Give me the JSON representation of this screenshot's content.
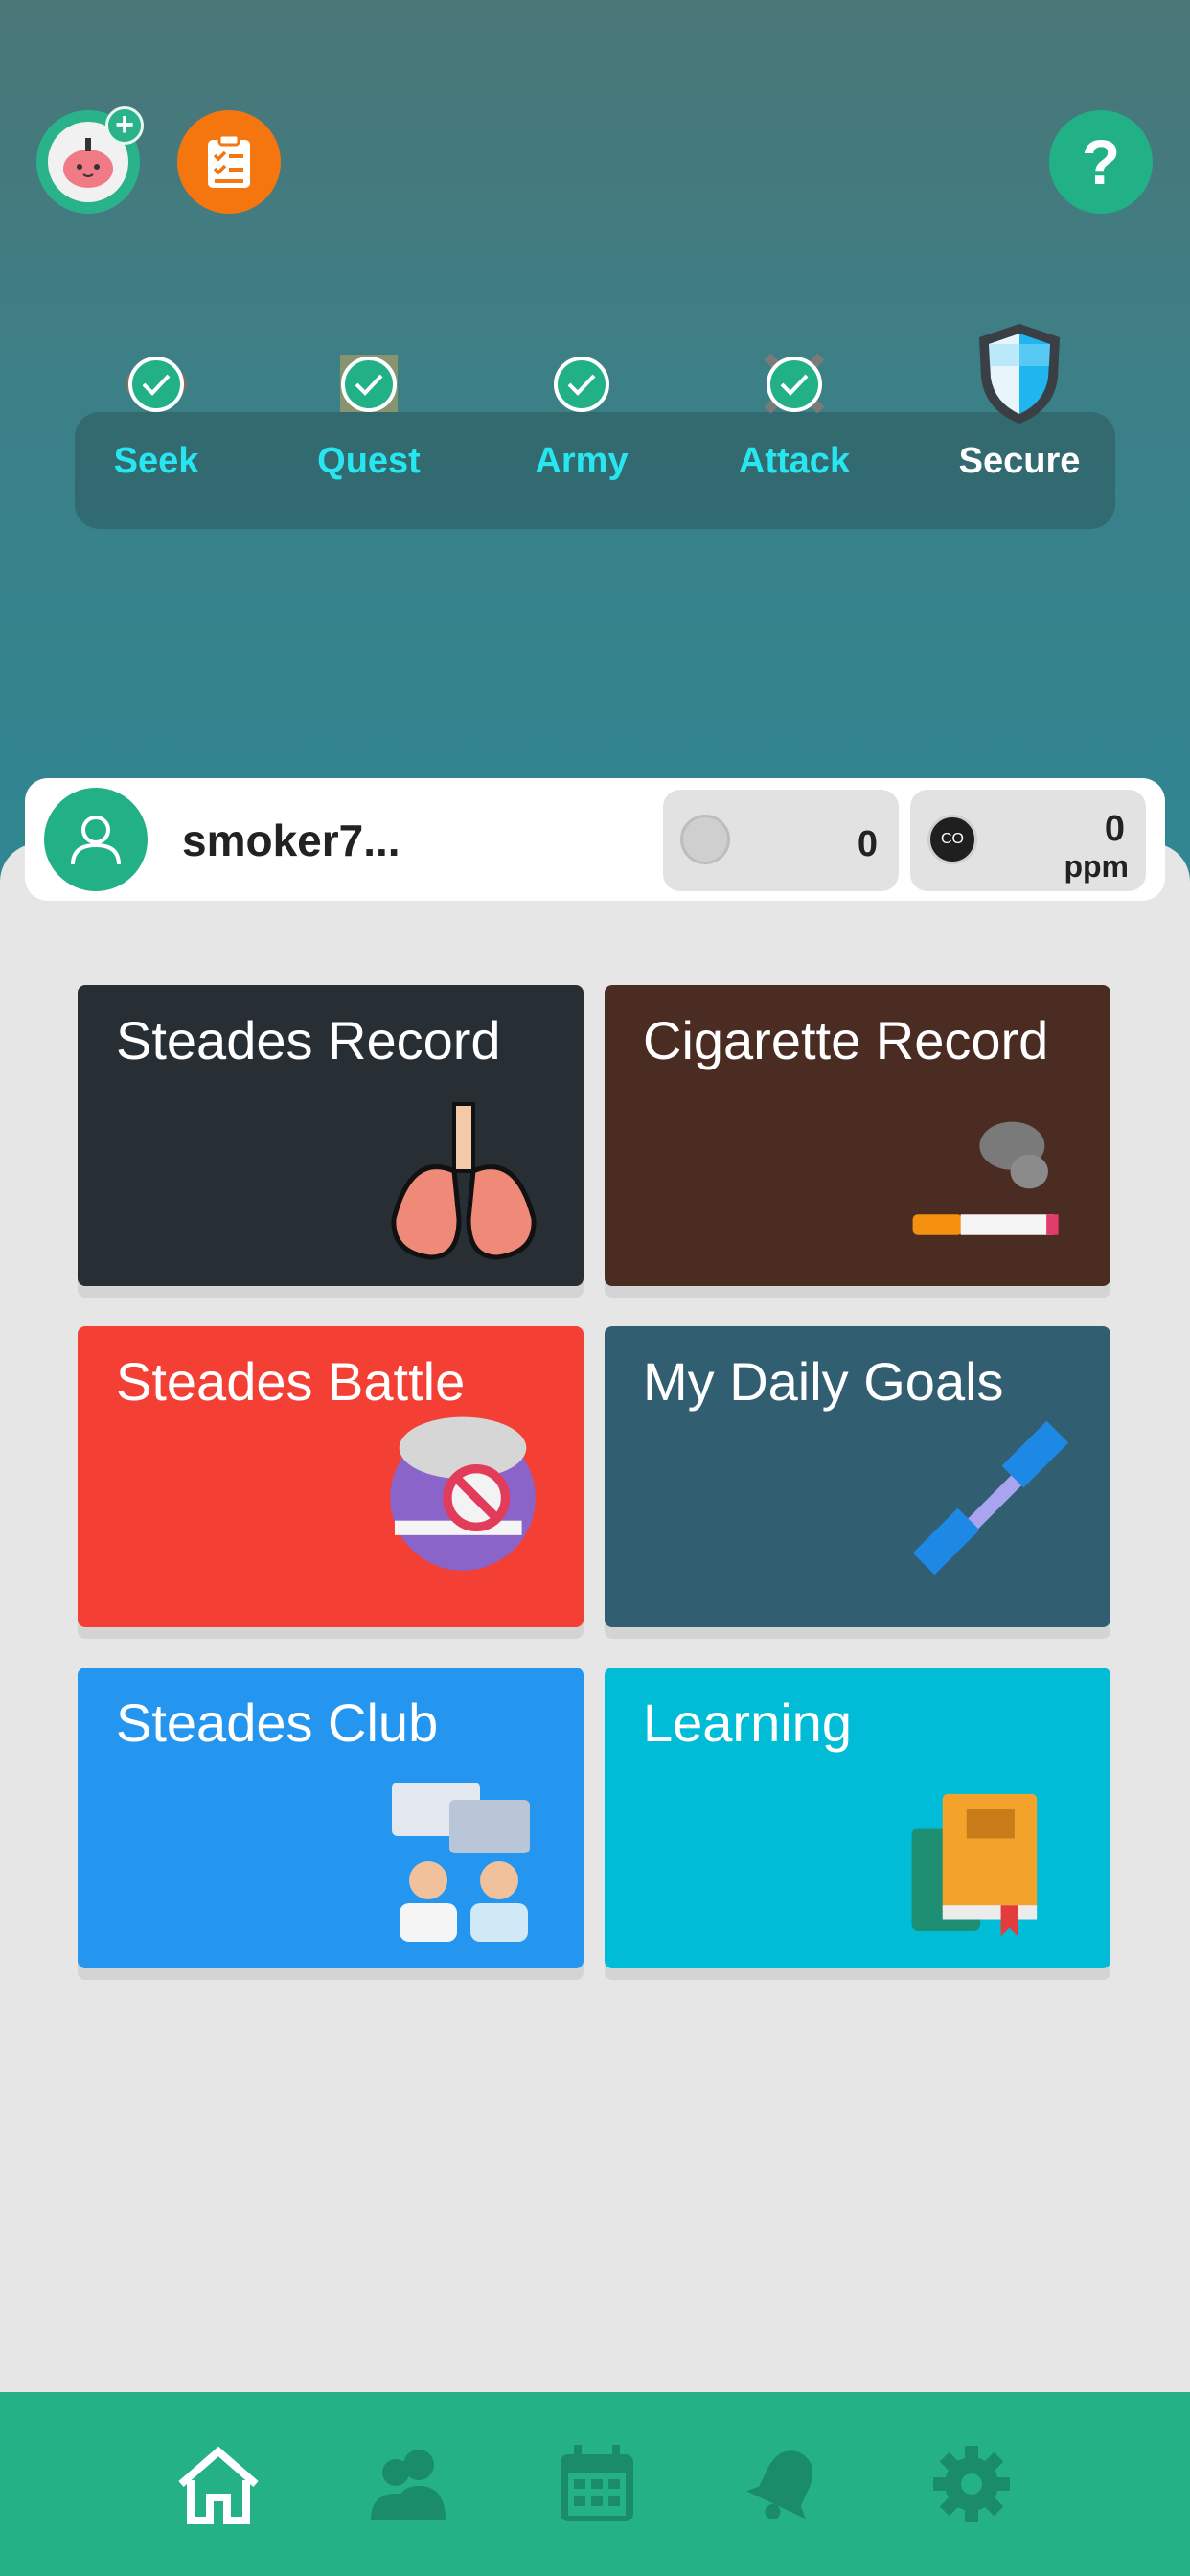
{
  "header": {
    "avatar_badge": "+",
    "help_label": "?"
  },
  "stages": [
    {
      "label": "Seek",
      "done": true,
      "icon": "binoculars-icon"
    },
    {
      "label": "Quest",
      "done": true,
      "icon": "map-icon"
    },
    {
      "label": "Army",
      "done": true,
      "icon": "helmet-icon"
    },
    {
      "label": "Attack",
      "done": true,
      "icon": "crossed-swords-icon"
    },
    {
      "label": "Secure",
      "done": false,
      "icon": "shield-icon"
    }
  ],
  "profile": {
    "username": "smoker7...",
    "coins": "0",
    "co_value": "0",
    "co_unit": "ppm",
    "co_icon_text": "CO"
  },
  "tiles": [
    {
      "title": "Steades Record",
      "color": "#272e34",
      "icon": "lungs-icon"
    },
    {
      "title": "Cigarette Record",
      "color": "#4b2c22",
      "icon": "cigarette-icon"
    },
    {
      "title": "Steades Battle",
      "color": "#f43f35",
      "icon": "no-smoking-icon"
    },
    {
      "title": "My Daily Goals",
      "color": "#325e72",
      "icon": "dumbbell-icon"
    },
    {
      "title": "Steades Club",
      "color": "#2596f0",
      "icon": "chat-people-icon"
    },
    {
      "title": "Learning",
      "color": "#00bcd6",
      "icon": "books-icon"
    }
  ],
  "nav": [
    {
      "icon": "home-icon",
      "active": true
    },
    {
      "icon": "friends-icon",
      "active": false
    },
    {
      "icon": "calendar-icon",
      "active": false
    },
    {
      "icon": "bell-icon",
      "active": false
    },
    {
      "icon": "gear-icon",
      "active": false
    }
  ],
  "colors": {
    "accent": "#22b086",
    "stage_label": "#27e6f0",
    "nav_inactive": "#1a8c68"
  }
}
